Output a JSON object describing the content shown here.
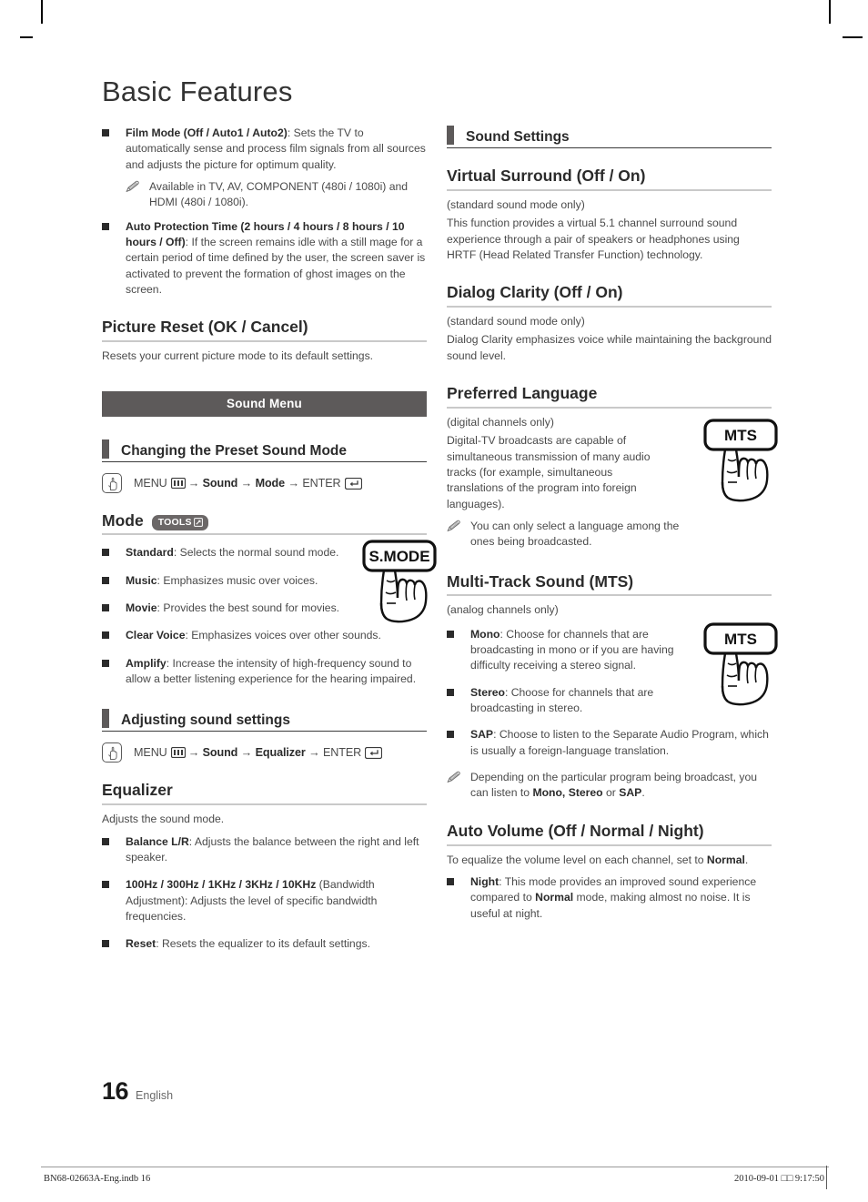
{
  "page": {
    "title": "Basic Features",
    "page_number": "16",
    "language_label": "English"
  },
  "left_column": {
    "top_bullets": [
      {
        "bold": "Film Mode (Off / Auto1 / Auto2)",
        "text": ": Sets the TV to automatically sense and process film signals from all sources and adjusts the picture for optimum quality.",
        "note": "Available in TV, AV, COMPONENT (480i / 1080i) and HDMI (480i / 1080i)."
      },
      {
        "bold": "Auto Protection Time (2 hours / 4 hours / 8 hours / 10 hours / Off)",
        "text": ": If the screen remains idle with a still mage for a certain period of time defined by the user, the screen saver is activated to prevent the formation of ghost images on the screen."
      }
    ],
    "picture_reset": {
      "heading": "Picture Reset (OK / Cancel)",
      "body": "Resets your current picture mode to its default settings."
    },
    "sound_menu_bar": "Sound Menu",
    "changing_preset": {
      "heading": "Changing the Preset Sound Mode",
      "path_prefix": "MENU",
      "path_middle_1": "Sound",
      "path_middle_2": "Mode",
      "path_suffix": "ENTER",
      "arrow": "→"
    },
    "mode": {
      "heading": "Mode",
      "badge": "TOOLS",
      "items": [
        {
          "bold": "Standard",
          "text": ": Selects the normal sound mode."
        },
        {
          "bold": "Music",
          "text": ": Emphasizes music over voices."
        },
        {
          "bold": "Movie",
          "text": ": Provides the best sound for movies."
        },
        {
          "bold": "Clear Voice",
          "text": ": Emphasizes voices over other sounds."
        },
        {
          "bold": "Amplify",
          "text": ": Increase the intensity of high-frequency sound to allow a better listening experience for the hearing impaired."
        }
      ],
      "remote_key": "S.MODE"
    },
    "adjusting_sound": {
      "heading": "Adjusting sound settings",
      "path_prefix": "MENU",
      "path_middle_1": "Sound",
      "path_middle_2": "Equalizer",
      "path_suffix": "ENTER",
      "arrow": "→"
    },
    "equalizer": {
      "heading": "Equalizer",
      "body": "Adjusts the sound mode.",
      "items": [
        {
          "bold": "Balance L/R",
          "text": ": Adjusts the balance between the right and left speaker."
        },
        {
          "bold": "100Hz / 300Hz / 1KHz / 3KHz / 10KHz",
          "text": " (Bandwidth Adjustment): Adjusts the level of specific bandwidth frequencies."
        },
        {
          "bold": "Reset",
          "text": ": Resets the equalizer to its default settings."
        }
      ]
    }
  },
  "right_column": {
    "sound_settings_heading": "Sound Settings",
    "virtual_surround": {
      "heading": "Virtual Surround (Off / On)",
      "subnote": "(standard sound mode only)",
      "body": "This function provides a virtual 5.1 channel surround sound experience through a pair of speakers or headphones using HRTF (Head Related Transfer Function) technology."
    },
    "dialog_clarity": {
      "heading": "Dialog Clarity (Off / On)",
      "subnote": "(standard sound mode only)",
      "body": "Dialog Clarity emphasizes voice while maintaining the background sound level."
    },
    "preferred_language": {
      "heading": "Preferred Language",
      "subnote": "(digital channels only)",
      "body": "Digital-TV broadcasts are capable of simultaneous transmission of many audio tracks (for example, simultaneous translations of the program into foreign languages).",
      "note": "You can only select a language among the ones being broadcasted.",
      "remote_key": "MTS"
    },
    "multi_track_sound": {
      "heading": "Multi-Track Sound (MTS)",
      "subnote": "(analog channels only)",
      "items": [
        {
          "bold": "Mono",
          "text": ": Choose for channels that are broadcasting in mono or if you are having difficulty receiving a stereo signal."
        },
        {
          "bold": "Stereo",
          "text": ": Choose for channels that are broadcasting in stereo."
        },
        {
          "bold": "SAP",
          "text": ": Choose to listen to the Separate Audio Program, which is usually a foreign-language translation."
        }
      ],
      "note_pre": "Depending on the particular program being broadcast, you can listen to ",
      "note_bold_1": "Mono, Stereo",
      "note_mid": " or ",
      "note_bold_2": "SAP",
      "note_end": ".",
      "remote_key": "MTS"
    },
    "auto_volume": {
      "heading": "Auto Volume (Off / Normal / Night)",
      "body_pre": "To equalize the volume level on each channel, set to ",
      "body_bold": "Normal",
      "body_end": ".",
      "item": {
        "bold": "Night",
        "text_pre": ": This mode provides an improved sound experience compared to ",
        "text_bold": "Normal",
        "text_end": " mode, making almost no noise. It is useful at night."
      }
    }
  },
  "footer": {
    "left": "BN68-02663A-Eng.indb   16",
    "right": "2010-09-01   □□ 9:17:50"
  }
}
